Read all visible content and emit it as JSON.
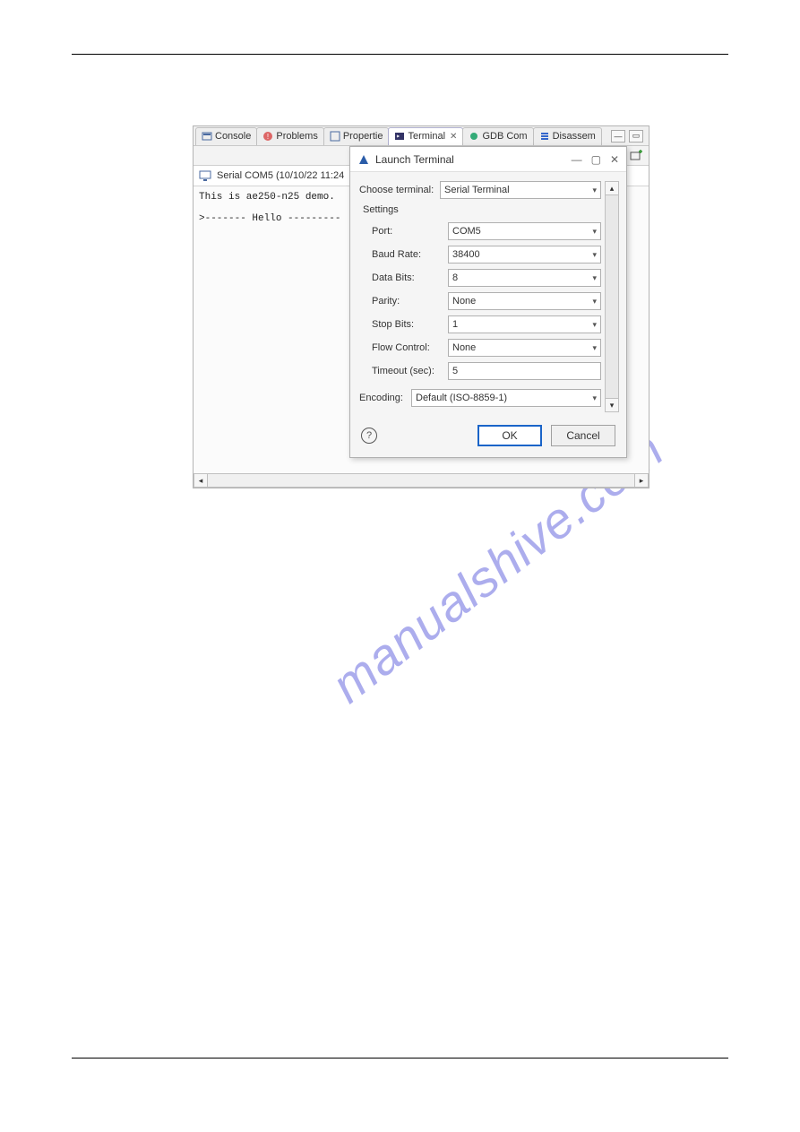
{
  "tabs": {
    "console": "Console",
    "problems": "Problems",
    "properties": "Propertie",
    "terminal": "Terminal",
    "gdb": "GDB Com",
    "disassem": "Disassem"
  },
  "console_title": "Serial COM5 (10/10/22 11:24",
  "terminal_lines": {
    "l1": "This is ae250-n25 demo.",
    "l2": ">------- Hello ---------"
  },
  "dialog": {
    "title": "Launch Terminal",
    "choose_label": "Choose terminal:",
    "choose_value": "Serial Terminal",
    "settings_label": "Settings",
    "port_label": "Port:",
    "port_value": "COM5",
    "baud_label": "Baud Rate:",
    "baud_value": "38400",
    "databits_label": "Data Bits:",
    "databits_value": "8",
    "parity_label": "Parity:",
    "parity_value": "None",
    "stopbits_label": "Stop Bits:",
    "stopbits_value": "1",
    "flow_label": "Flow Control:",
    "flow_value": "None",
    "timeout_label": "Timeout (sec):",
    "timeout_value": "5",
    "encoding_label": "Encoding:",
    "encoding_value": "Default (ISO-8859-1)",
    "ok": "OK",
    "cancel": "Cancel"
  },
  "watermark": "manualshive.com"
}
